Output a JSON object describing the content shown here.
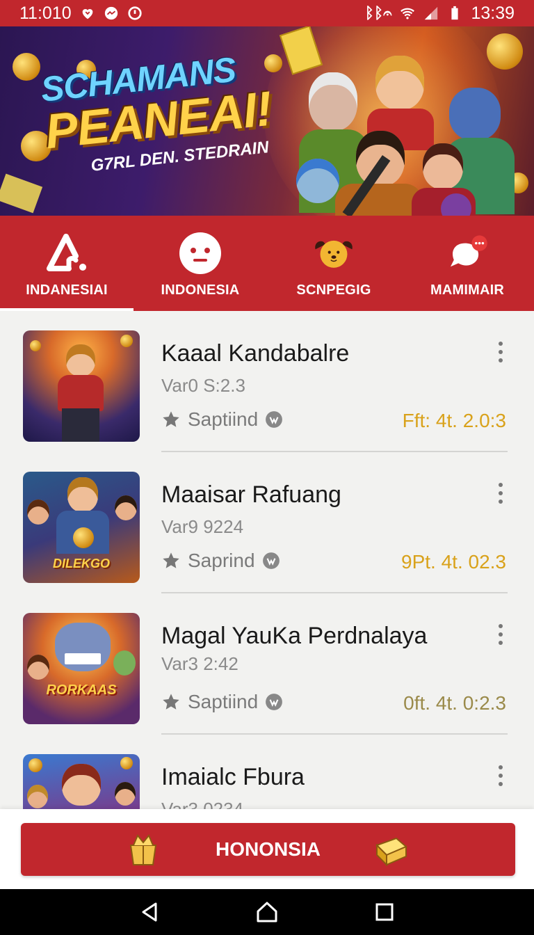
{
  "status_bar": {
    "time_left": "11:010",
    "signal_text": "ᛒ",
    "time_right": "13:39"
  },
  "banner": {
    "title_line1": "SCHAMANS",
    "title_line2": "PEANEAI",
    "title_exclaim": "!",
    "subtitle": "G7RL DEN. STEDRAIN"
  },
  "tabs": [
    {
      "label": "INDANESIAI",
      "icon": "warning-triangle-icon",
      "active": true
    },
    {
      "label": "INDONESIA",
      "icon": "face-icon",
      "active": false
    },
    {
      "label": "SCNPEGIG",
      "icon": "dog-icon",
      "active": false
    },
    {
      "label": "MAMIMAIR",
      "icon": "chat-bubble-icon",
      "active": false
    }
  ],
  "list": {
    "items": [
      {
        "title": "Kaaal Kandabalre",
        "subtitle": "Var0 S:2.3",
        "rating_label": "Saptiind",
        "price": "Fft: 4t. 2.0:3"
      },
      {
        "title": "Maaisar Rafuang",
        "subtitle": "Var9 9224",
        "rating_label": "Saprind",
        "price": "9Pt. 4t. 02.3"
      },
      {
        "title": "Magal YauKa Perdnalaya",
        "subtitle": "Var3 2:42",
        "rating_label": "Saptiind",
        "price": "0ft. 4t. 0:2.3"
      },
      {
        "title": "Imaialc Fbura",
        "subtitle": "Var3 0234",
        "rating_label": "",
        "price": ""
      }
    ],
    "thumb_texts": [
      "",
      "DILEKGO",
      "RORKAAS",
      ""
    ]
  },
  "cta": {
    "label": "HONONSIA"
  },
  "colors": {
    "primary_red": "#c1272d",
    "price_gold": "#d9a21b",
    "background": "#f2f2f0"
  }
}
